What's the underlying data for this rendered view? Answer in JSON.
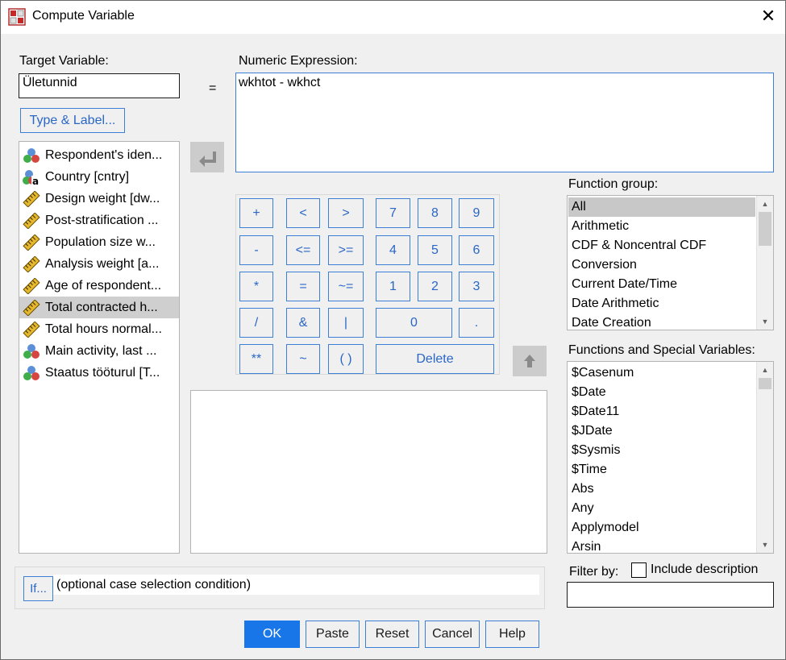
{
  "window": {
    "title": "Compute Variable",
    "close_glyph": "✕"
  },
  "target": {
    "label": "Target Variable:",
    "value": "Ületunnid",
    "type_label_button": "Type & Label..."
  },
  "equals": "=",
  "expression": {
    "label": "Numeric Expression:",
    "value": "wkhtot - wkhct"
  },
  "variables": [
    {
      "label": "Respondent's iden...",
      "icon": "nominal-icon"
    },
    {
      "label": "Country [cntry]",
      "icon": "nominal-string-icon"
    },
    {
      "label": "Design weight [dw...",
      "icon": "scale-ruler-icon"
    },
    {
      "label": "Post-stratification ...",
      "icon": "scale-ruler-icon"
    },
    {
      "label": "Population size w...",
      "icon": "scale-ruler-icon"
    },
    {
      "label": "Analysis weight [a...",
      "icon": "scale-ruler-icon"
    },
    {
      "label": "Age of respondent...",
      "icon": "scale-ruler-icon"
    },
    {
      "label": "Total contracted h...",
      "icon": "scale-ruler-icon",
      "selected": true
    },
    {
      "label": "Total hours normal...",
      "icon": "scale-ruler-icon"
    },
    {
      "label": "Main activity, last ...",
      "icon": "nominal-icon"
    },
    {
      "label": "Staatus tööturul [T...",
      "icon": "nominal-icon"
    }
  ],
  "calculator": {
    "plus": "+",
    "lt": "<",
    "gt": ">",
    "n7": "7",
    "n8": "8",
    "n9": "9",
    "minus": "-",
    "le": "<=",
    "ge": ">=",
    "n4": "4",
    "n5": "5",
    "n6": "6",
    "mult": "*",
    "eq": "=",
    "ne": "~=",
    "n1": "1",
    "n2": "2",
    "n3": "3",
    "div": "/",
    "and": "&",
    "or": "|",
    "n0": "0",
    "dot": ".",
    "pow": "**",
    "not": "~",
    "paren": "( )",
    "delete": "Delete"
  },
  "function_group": {
    "label": "Function group:",
    "items": [
      "All",
      "Arithmetic",
      "CDF & Noncentral CDF",
      "Conversion",
      "Current Date/Time",
      "Date Arithmetic",
      "Date Creation"
    ]
  },
  "functions": {
    "label": "Functions and Special Variables:",
    "items": [
      "$Casenum",
      "$Date",
      "$Date11",
      "$JDate",
      "$Sysmis",
      "$Time",
      "Abs",
      "Any",
      "Applymodel",
      "Arsin"
    ]
  },
  "if_section": {
    "button": "If...",
    "text": "(optional case selection condition)"
  },
  "filter": {
    "label": "Filter by:",
    "checkbox_label": "Include description",
    "checked": false
  },
  "buttons": {
    "ok": "OK",
    "paste": "Paste",
    "reset": "Reset",
    "cancel": "Cancel",
    "help": "Help"
  },
  "colors": {
    "accent": "#1976e8",
    "link_blue": "#2a66c6",
    "selection": "#cfcfcf"
  }
}
